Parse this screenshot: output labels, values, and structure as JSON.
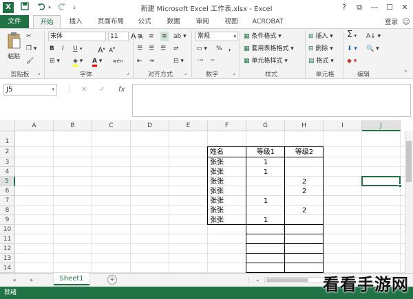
{
  "window": {
    "title": "新建 Microsoft Excel 工作表.xlsx - Excel",
    "help": "?",
    "ribbon_display": "⧉",
    "minimize": "—",
    "maximize": "☐",
    "close": "✕"
  },
  "quick_access": {
    "app_icon": "X",
    "save_icon": "save-icon",
    "undo_icon": "undo-icon",
    "redo_icon": "redo-icon",
    "customize_icon": "customize-icon"
  },
  "tabs": {
    "file": "文件",
    "items": [
      "开始",
      "插入",
      "页面布局",
      "公式",
      "数据",
      "审阅",
      "视图",
      "ACROBAT"
    ],
    "active": "开始",
    "sign_in": "登录"
  },
  "ribbon": {
    "clipboard": {
      "label": "剪贴板",
      "paste": "粘贴"
    },
    "font": {
      "label": "字体",
      "name": "宋体",
      "size": "11",
      "bold": "B",
      "italic": "I",
      "underline": "U",
      "grow": "A",
      "shrink": "A",
      "font_color": "A",
      "phonetic": "wén"
    },
    "alignment": {
      "label": "对齐方式"
    },
    "number": {
      "label": "数字",
      "format": "常规",
      "percent": "%",
      "comma": ","
    },
    "styles": {
      "label": "样式",
      "conditional": "条件格式",
      "table": "套用表格格式",
      "cell_styles": "单元格样式"
    },
    "cells": {
      "label": "单元格",
      "insert": "插入",
      "delete": "删除",
      "format": "格式"
    },
    "editing": {
      "label": "编辑",
      "sum": "Σ"
    }
  },
  "formula_bar": {
    "name_box": "J5",
    "cancel": "✕",
    "enter": "✓",
    "fx": "fx",
    "content": ""
  },
  "grid": {
    "columns": [
      "A",
      "B",
      "C",
      "D",
      "E",
      "F",
      "G",
      "H",
      "I",
      "J"
    ],
    "rows": [
      "1",
      "2",
      "3",
      "4",
      "5",
      "6",
      "7",
      "8",
      "9",
      "10",
      "11",
      "12",
      "13",
      "14"
    ],
    "selected_cell": "J5",
    "headers": {
      "name": "姓名",
      "level1": "等级1",
      "level2": "等级2"
    },
    "data": [
      {
        "name": "张张",
        "level1": "1",
        "level2": ""
      },
      {
        "name": "张张",
        "level1": "1",
        "level2": ""
      },
      {
        "name": "张张",
        "level1": "",
        "level2": "2"
      },
      {
        "name": "张张",
        "level1": "",
        "level2": "2"
      },
      {
        "name": "张张",
        "level1": "1",
        "level2": ""
      },
      {
        "name": "张张",
        "level1": "",
        "level2": "2"
      },
      {
        "name": "张张",
        "level1": "1",
        "level2": ""
      }
    ]
  },
  "sheets": {
    "names": [
      "Sheet1"
    ],
    "active": "Sheet1",
    "add": "+"
  },
  "status": {
    "text": "就绪"
  },
  "watermark": "看看手游网",
  "colors": {
    "excel_green": "#217346",
    "ribbon_bg": "#f3f3f3",
    "selection": "#217346"
  }
}
